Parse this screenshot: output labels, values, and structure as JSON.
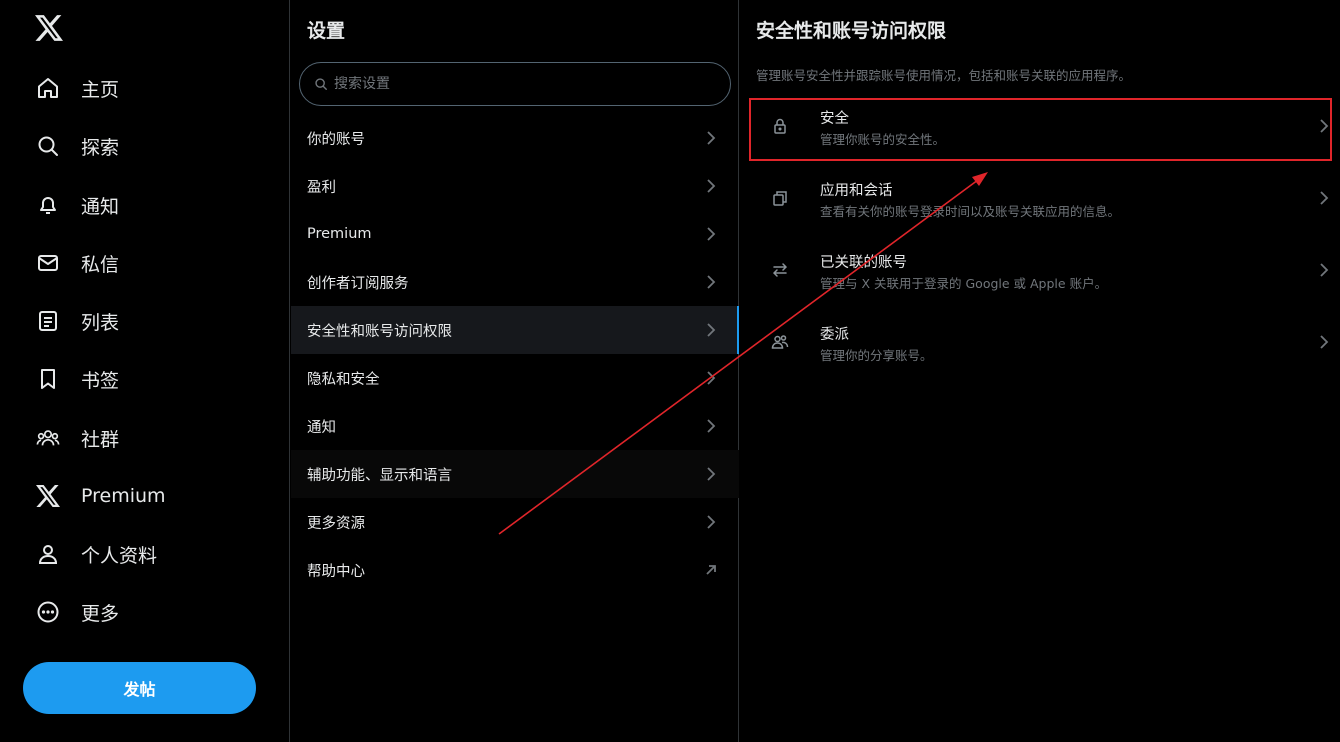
{
  "nav": {
    "items": [
      {
        "label": "主页",
        "icon": "home-icon"
      },
      {
        "label": "探索",
        "icon": "search-icon"
      },
      {
        "label": "通知",
        "icon": "bell-icon"
      },
      {
        "label": "私信",
        "icon": "envelope-icon"
      },
      {
        "label": "列表",
        "icon": "list-icon"
      },
      {
        "label": "书签",
        "icon": "bookmark-icon"
      },
      {
        "label": "社群",
        "icon": "communities-icon"
      },
      {
        "label": "Premium",
        "icon": "x-logo-icon"
      },
      {
        "label": "个人资料",
        "icon": "person-icon"
      },
      {
        "label": "更多",
        "icon": "more-circle-icon"
      }
    ],
    "post_label": "发帖"
  },
  "settings": {
    "title": "设置",
    "search_placeholder": "搜索设置",
    "items": [
      {
        "label": "你的账号",
        "icon": "chevron-right-icon"
      },
      {
        "label": "盈利",
        "icon": "chevron-right-icon"
      },
      {
        "label": "Premium",
        "icon": "chevron-right-icon"
      },
      {
        "label": "创作者订阅服务",
        "icon": "chevron-right-icon"
      },
      {
        "label": "安全性和账号访问权限",
        "icon": "chevron-right-icon",
        "selected": true
      },
      {
        "label": "隐私和安全",
        "icon": "chevron-right-icon"
      },
      {
        "label": "通知",
        "icon": "chevron-right-icon"
      },
      {
        "label": "辅助功能、显示和语言",
        "icon": "chevron-right-icon"
      },
      {
        "label": "更多资源",
        "icon": "chevron-right-icon"
      },
      {
        "label": "帮助中心",
        "icon": "external-link-icon"
      }
    ]
  },
  "detail": {
    "title": "安全性和账号访问权限",
    "description": "管理账号安全性并跟踪账号使用情况，包括和账号关联的应用程序。",
    "items": [
      {
        "label": "安全",
        "sub": "管理你账号的安全性。",
        "icon": "lock-icon"
      },
      {
        "label": "应用和会话",
        "sub": "查看有关你的账号登录时间以及账号关联应用的信息。",
        "icon": "copy-icon"
      },
      {
        "label": "已关联的账号",
        "sub": "管理与 X 关联用于登录的 Google 或 Apple 账户。",
        "icon": "swap-arrows-icon"
      },
      {
        "label": "委派",
        "sub": "管理你的分享账号。",
        "icon": "people-icon"
      }
    ]
  },
  "colors": {
    "background": "#000000",
    "text": "#e7e9ea",
    "muted": "#71767b",
    "accent": "#1d9bf0",
    "annotation": "#e0252a"
  }
}
